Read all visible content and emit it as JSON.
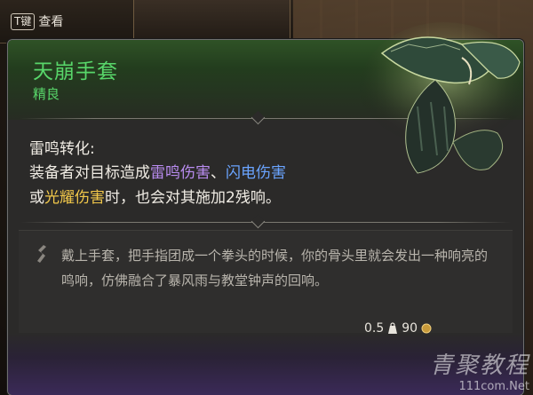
{
  "hud": {
    "key_badge": "T键",
    "key_label": "查看"
  },
  "item": {
    "name": "天崩手套",
    "rarity": "精良",
    "rarity_color": "#58d66a",
    "effect_title": "雷鸣转化:",
    "effect_line1_prefix": "装备者对目标造成",
    "effect_thunder": "雷鸣伤害",
    "effect_sep": "、",
    "effect_lightning": "闪电伤害",
    "effect_line2_prefix": "或",
    "effect_radiant": "光耀伤害",
    "effect_line2_suffix": "时，也会对其施加2残响。",
    "flavor_text": "戴上手套，把手指团成一个拳头的时候，你的骨头里就会发出一种响亮的鸣响，仿佛融合了暴风雨与教堂钟声的回响。",
    "weight": "0.5",
    "value": "90",
    "icons": {
      "weight": "weight-icon",
      "value": "coin-icon",
      "flavor": "quill-icon",
      "art": "gauntlet-icon"
    },
    "colors": {
      "thunder": "#b98cf0",
      "lightning": "#6aa4ff",
      "radiant": "#f2c84a"
    }
  },
  "watermark": {
    "brand": "青聚教程",
    "url": "111com.Net"
  }
}
